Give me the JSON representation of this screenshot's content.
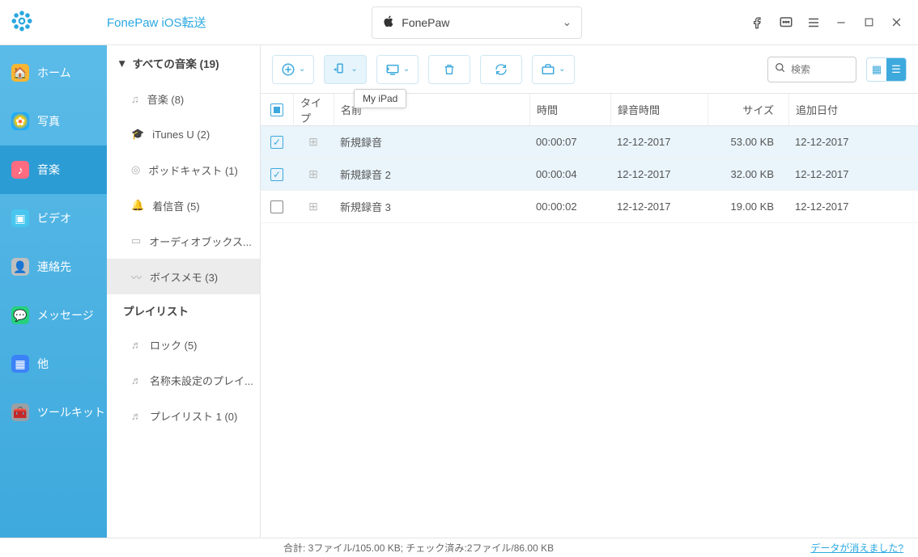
{
  "app_title": "FonePaw iOS転送",
  "device_label": "FonePaw",
  "tooltip": "My iPad",
  "search_placeholder": "検索",
  "sidebar": {
    "items": [
      {
        "label": "ホーム"
      },
      {
        "label": "写真"
      },
      {
        "label": "音楽"
      },
      {
        "label": "ビデオ"
      },
      {
        "label": "連絡先"
      },
      {
        "label": "メッセージ"
      },
      {
        "label": "他"
      },
      {
        "label": "ツールキット"
      }
    ]
  },
  "subpanel": {
    "all_music": "すべての音楽 (19)",
    "items": [
      {
        "label": "音楽 (8)"
      },
      {
        "label": "iTunes U (2)"
      },
      {
        "label": "ポッドキャスト (1)"
      },
      {
        "label": "着信音 (5)"
      },
      {
        "label": "オーディオブックス..."
      },
      {
        "label": "ボイスメモ (3)"
      }
    ],
    "playlists_header": "プレイリスト",
    "playlists": [
      {
        "label": "ロック (5)"
      },
      {
        "label": "名称未設定のプレイ..."
      },
      {
        "label": "プレイリスト 1 (0)"
      }
    ]
  },
  "columns": {
    "type": "タイプ",
    "name": "名前",
    "duration": "時間",
    "recorded": "録音時間",
    "size": "サイズ",
    "added": "追加日付"
  },
  "rows": [
    {
      "checked": true,
      "name": "新規録音",
      "dur": "00:00:07",
      "rec": "12-12-2017",
      "size": "53.00 KB",
      "date": "12-12-2017"
    },
    {
      "checked": true,
      "name": "新規録音 2",
      "dur": "00:00:04",
      "rec": "12-12-2017",
      "size": "32.00 KB",
      "date": "12-12-2017"
    },
    {
      "checked": false,
      "name": "新規録音 3",
      "dur": "00:00:02",
      "rec": "12-12-2017",
      "size": "19.00 KB",
      "date": "12-12-2017"
    }
  ],
  "status_left": "合計: 3ファイル/105.00 KB; チェック済み:2ファイル/86.00 KB",
  "status_right": "データが消えました?"
}
